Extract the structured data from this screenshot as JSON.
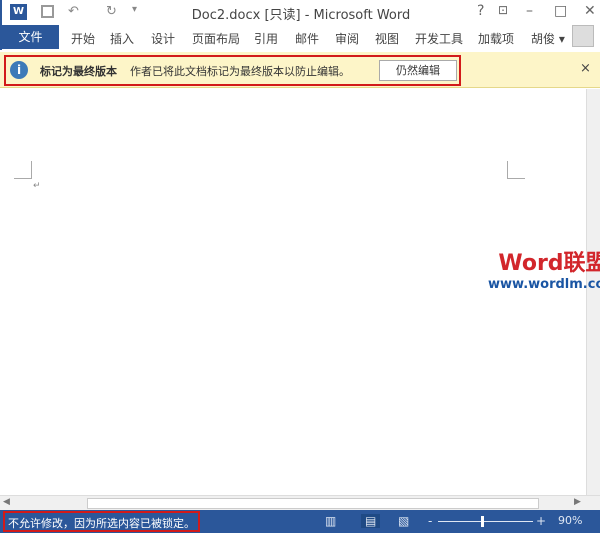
{
  "window": {
    "title": "Doc2.docx [只读] - Microsoft Word",
    "help": "?",
    "minimize": "–",
    "maximize": "□",
    "close": "✕",
    "undo": "↶",
    "redo": "↻",
    "qa_more": "₹"
  },
  "ribbon": {
    "file": "文件",
    "tabs": [
      "开始",
      "插入",
      "设计",
      "页面布局",
      "引用",
      "邮件",
      "审阅",
      "视图",
      "开发工具",
      "加载项"
    ],
    "user": "胡俊 ▾"
  },
  "message_bar": {
    "icon": "info-icon",
    "title": "标记为最终版本",
    "text": "作者已将此文档标记为最终版本以防止编辑。",
    "button": "仍然编辑",
    "close": "×"
  },
  "document": {
    "paragraph_mark": "↵"
  },
  "watermark": {
    "brand": "Word联盟",
    "url": "www.wordlm.com"
  },
  "status_bar": {
    "message": "不允许修改，因为所选内容已被锁定。",
    "zoom": "90%",
    "zoom_level": 0.45,
    "zoom_minus": "-",
    "zoom_plus": "+"
  },
  "colors": {
    "accent": "#2b579a",
    "message_bar": "#fdf5c8",
    "highlight": "#d21a1a"
  }
}
